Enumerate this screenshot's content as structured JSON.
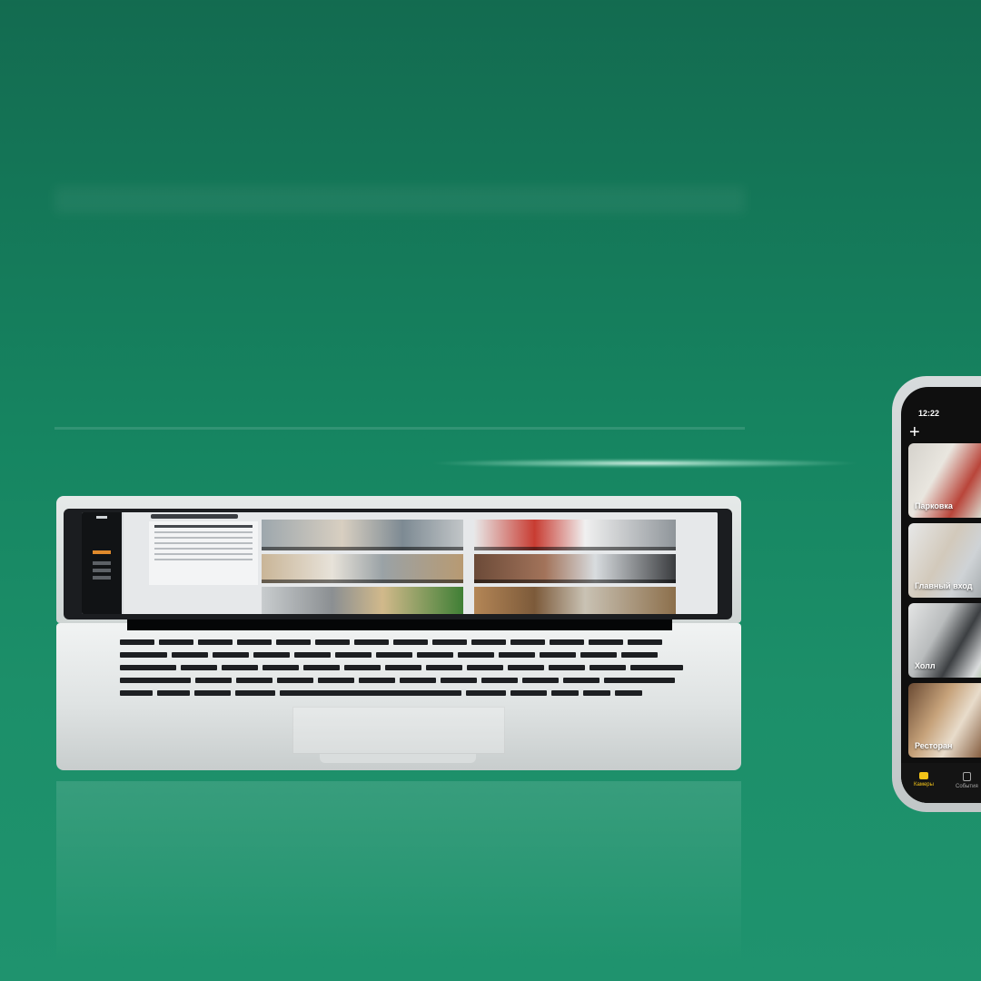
{
  "phone": {
    "status_time": "12:22",
    "add_button": "+",
    "cameras": [
      {
        "label": "Парковка"
      },
      {
        "label": "Главный вход"
      },
      {
        "label": "Холл"
      },
      {
        "label": "Ресторан"
      }
    ],
    "tabs": [
      {
        "label": "Камеры",
        "active": true
      },
      {
        "label": "События",
        "active": false
      }
    ]
  },
  "colors": {
    "background": "#168561",
    "accent_yellow": "#f2c318",
    "laptop_active_nav": "#e08a2c"
  },
  "icons": [
    "camera-icon",
    "calendar-icon",
    "plus-icon"
  ]
}
